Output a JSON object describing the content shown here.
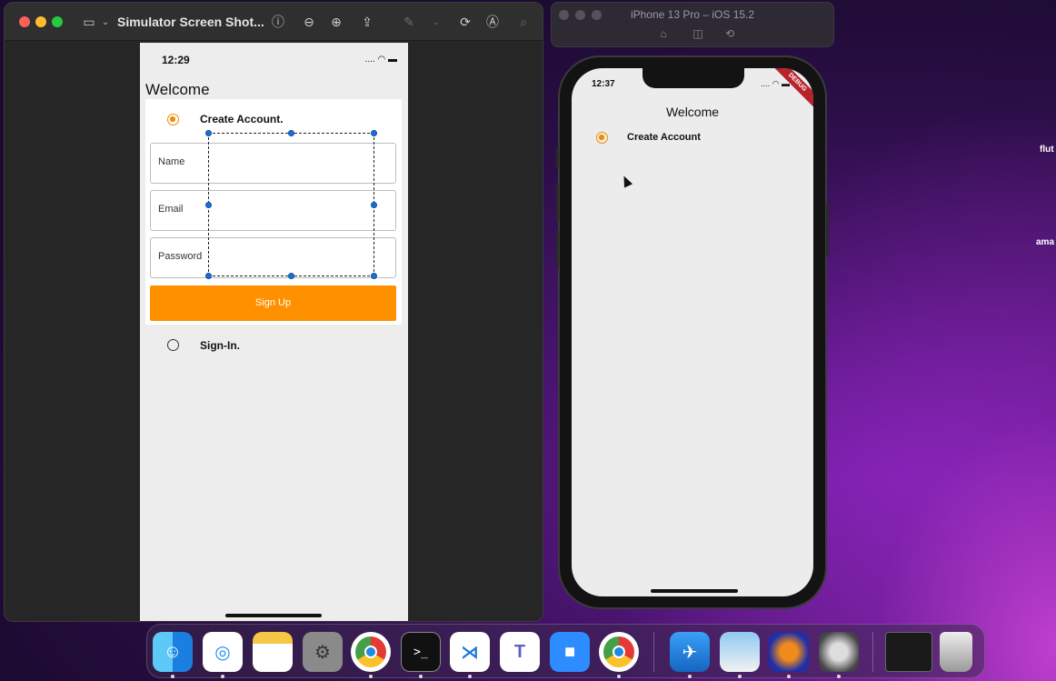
{
  "desktop": {
    "side_texts": [
      "flut",
      "ama"
    ]
  },
  "preview": {
    "window_title": "Simulator Screen Shot...",
    "screenshot": {
      "time": "12:29",
      "status_icons": ".... wifi battery",
      "heading": "Welcome",
      "option_create": "Create Account.",
      "option_signin": "Sign-In.",
      "field_name": "Name",
      "field_email": "Email",
      "field_password": "Password",
      "signup_button": "Sign Up"
    }
  },
  "simulator": {
    "window_title": "iPhone 13 Pro – iOS 15.2",
    "time": "12:37",
    "debug_banner": "DEBUG",
    "heading": "Welcome",
    "option_create": "Create Account"
  },
  "colors": {
    "accent_orange": "#ff9100",
    "radio_orange": "#f08c00",
    "selection_handle": "#1d6fd8"
  },
  "dock": {
    "apps": [
      "finder-icon",
      "safari-icon",
      "notes-icon",
      "system-preferences-icon",
      "chrome-icon",
      "terminal-icon",
      "vscode-icon",
      "teams-icon",
      "zoom-icon",
      "chrome-icon",
      "testflight-icon",
      "preview-icon",
      "audacity-icon",
      "quicktime-icon",
      "terminal-window-icon",
      "trash-icon"
    ]
  }
}
